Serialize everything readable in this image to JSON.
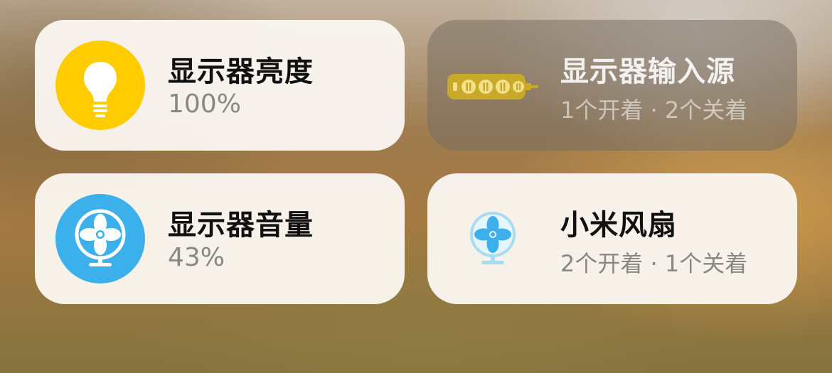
{
  "accessories": [
    {
      "title": "显示器亮度",
      "status": "100%",
      "state": "on",
      "icon": "lightbulb-icon",
      "icon_bg": "#FFCC00"
    },
    {
      "title": "显示器输入源",
      "status": "1个开着 · 2个关着",
      "state": "off",
      "icon": "power-strip-icon",
      "icon_color": "#C9A92A"
    },
    {
      "title": "显示器音量",
      "status": "43%",
      "state": "on",
      "icon": "fan-icon",
      "icon_bg": "#3BB0EA"
    },
    {
      "title": "小米风扇",
      "status": "2个开着 · 1个关着",
      "state": "on",
      "icon": "fan-icon",
      "icon_color": "#6EC8F0"
    }
  ]
}
